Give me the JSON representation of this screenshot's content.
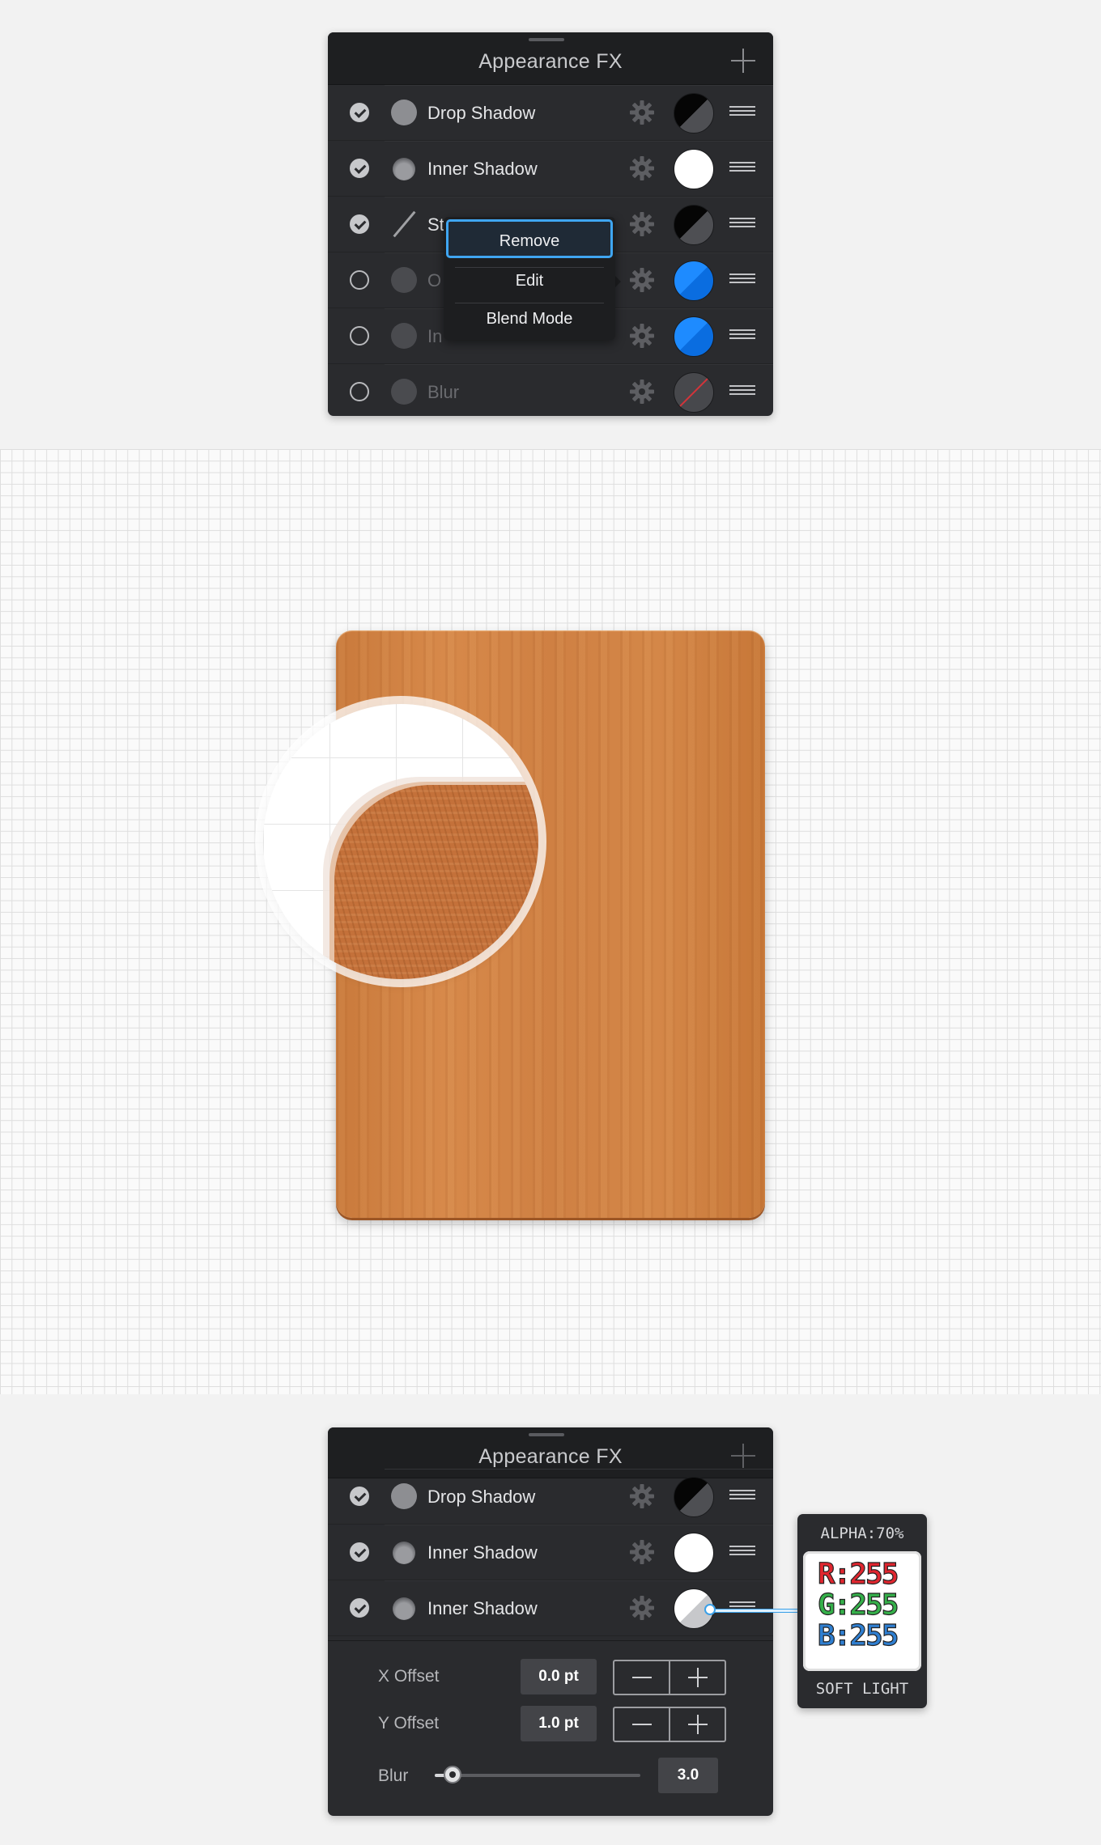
{
  "panel_top": {
    "title": "Appearance FX",
    "rows": [
      {
        "label": "Drop Shadow",
        "checked": true,
        "icon": "drop-shadow-icon",
        "swatch": "black"
      },
      {
        "label": "Inner Shadow",
        "checked": true,
        "icon": "inner-shadow-icon",
        "swatch": "white"
      },
      {
        "label": "St",
        "checked": true,
        "icon": "stroke-icon",
        "swatch": "black"
      },
      {
        "label": "O",
        "checked": false,
        "icon": "outer-glow-icon",
        "swatch": "blue"
      },
      {
        "label": "In",
        "checked": false,
        "icon": "inner-glow-icon",
        "swatch": "blue"
      },
      {
        "label": "Blur",
        "checked": false,
        "icon": "blur-icon",
        "swatch": "none"
      }
    ]
  },
  "context_menu": {
    "items": [
      "Remove",
      "Edit",
      "Blend Mode"
    ]
  },
  "panel_bottom": {
    "title": "Appearance FX",
    "rows": [
      {
        "label": "Drop Shadow",
        "checked": true,
        "swatch": "black"
      },
      {
        "label": "Inner Shadow",
        "checked": true,
        "swatch": "white"
      },
      {
        "label": "Inner Shadow",
        "checked": true,
        "swatch": "white-grey"
      }
    ],
    "x_offset": {
      "label": "X Offset",
      "value": "0.0 pt"
    },
    "y_offset": {
      "label": "Y Offset",
      "value": "1.0 pt"
    },
    "blur": {
      "label": "Blur",
      "value": "3.0",
      "slider_fraction": 0.06
    }
  },
  "callout": {
    "alpha": "ALPHA:70%",
    "r": "R:255",
    "g": "G:255",
    "b": "B:255",
    "blend_mode": "SOFT LIGHT",
    "colors": {
      "r": "#e0262f",
      "g": "#35b04a",
      "b": "#2f7fd1"
    }
  },
  "colors": {
    "panel_bg": "#2a2b2e",
    "accent": "#3fa6f2",
    "wood": "#cf8043"
  }
}
